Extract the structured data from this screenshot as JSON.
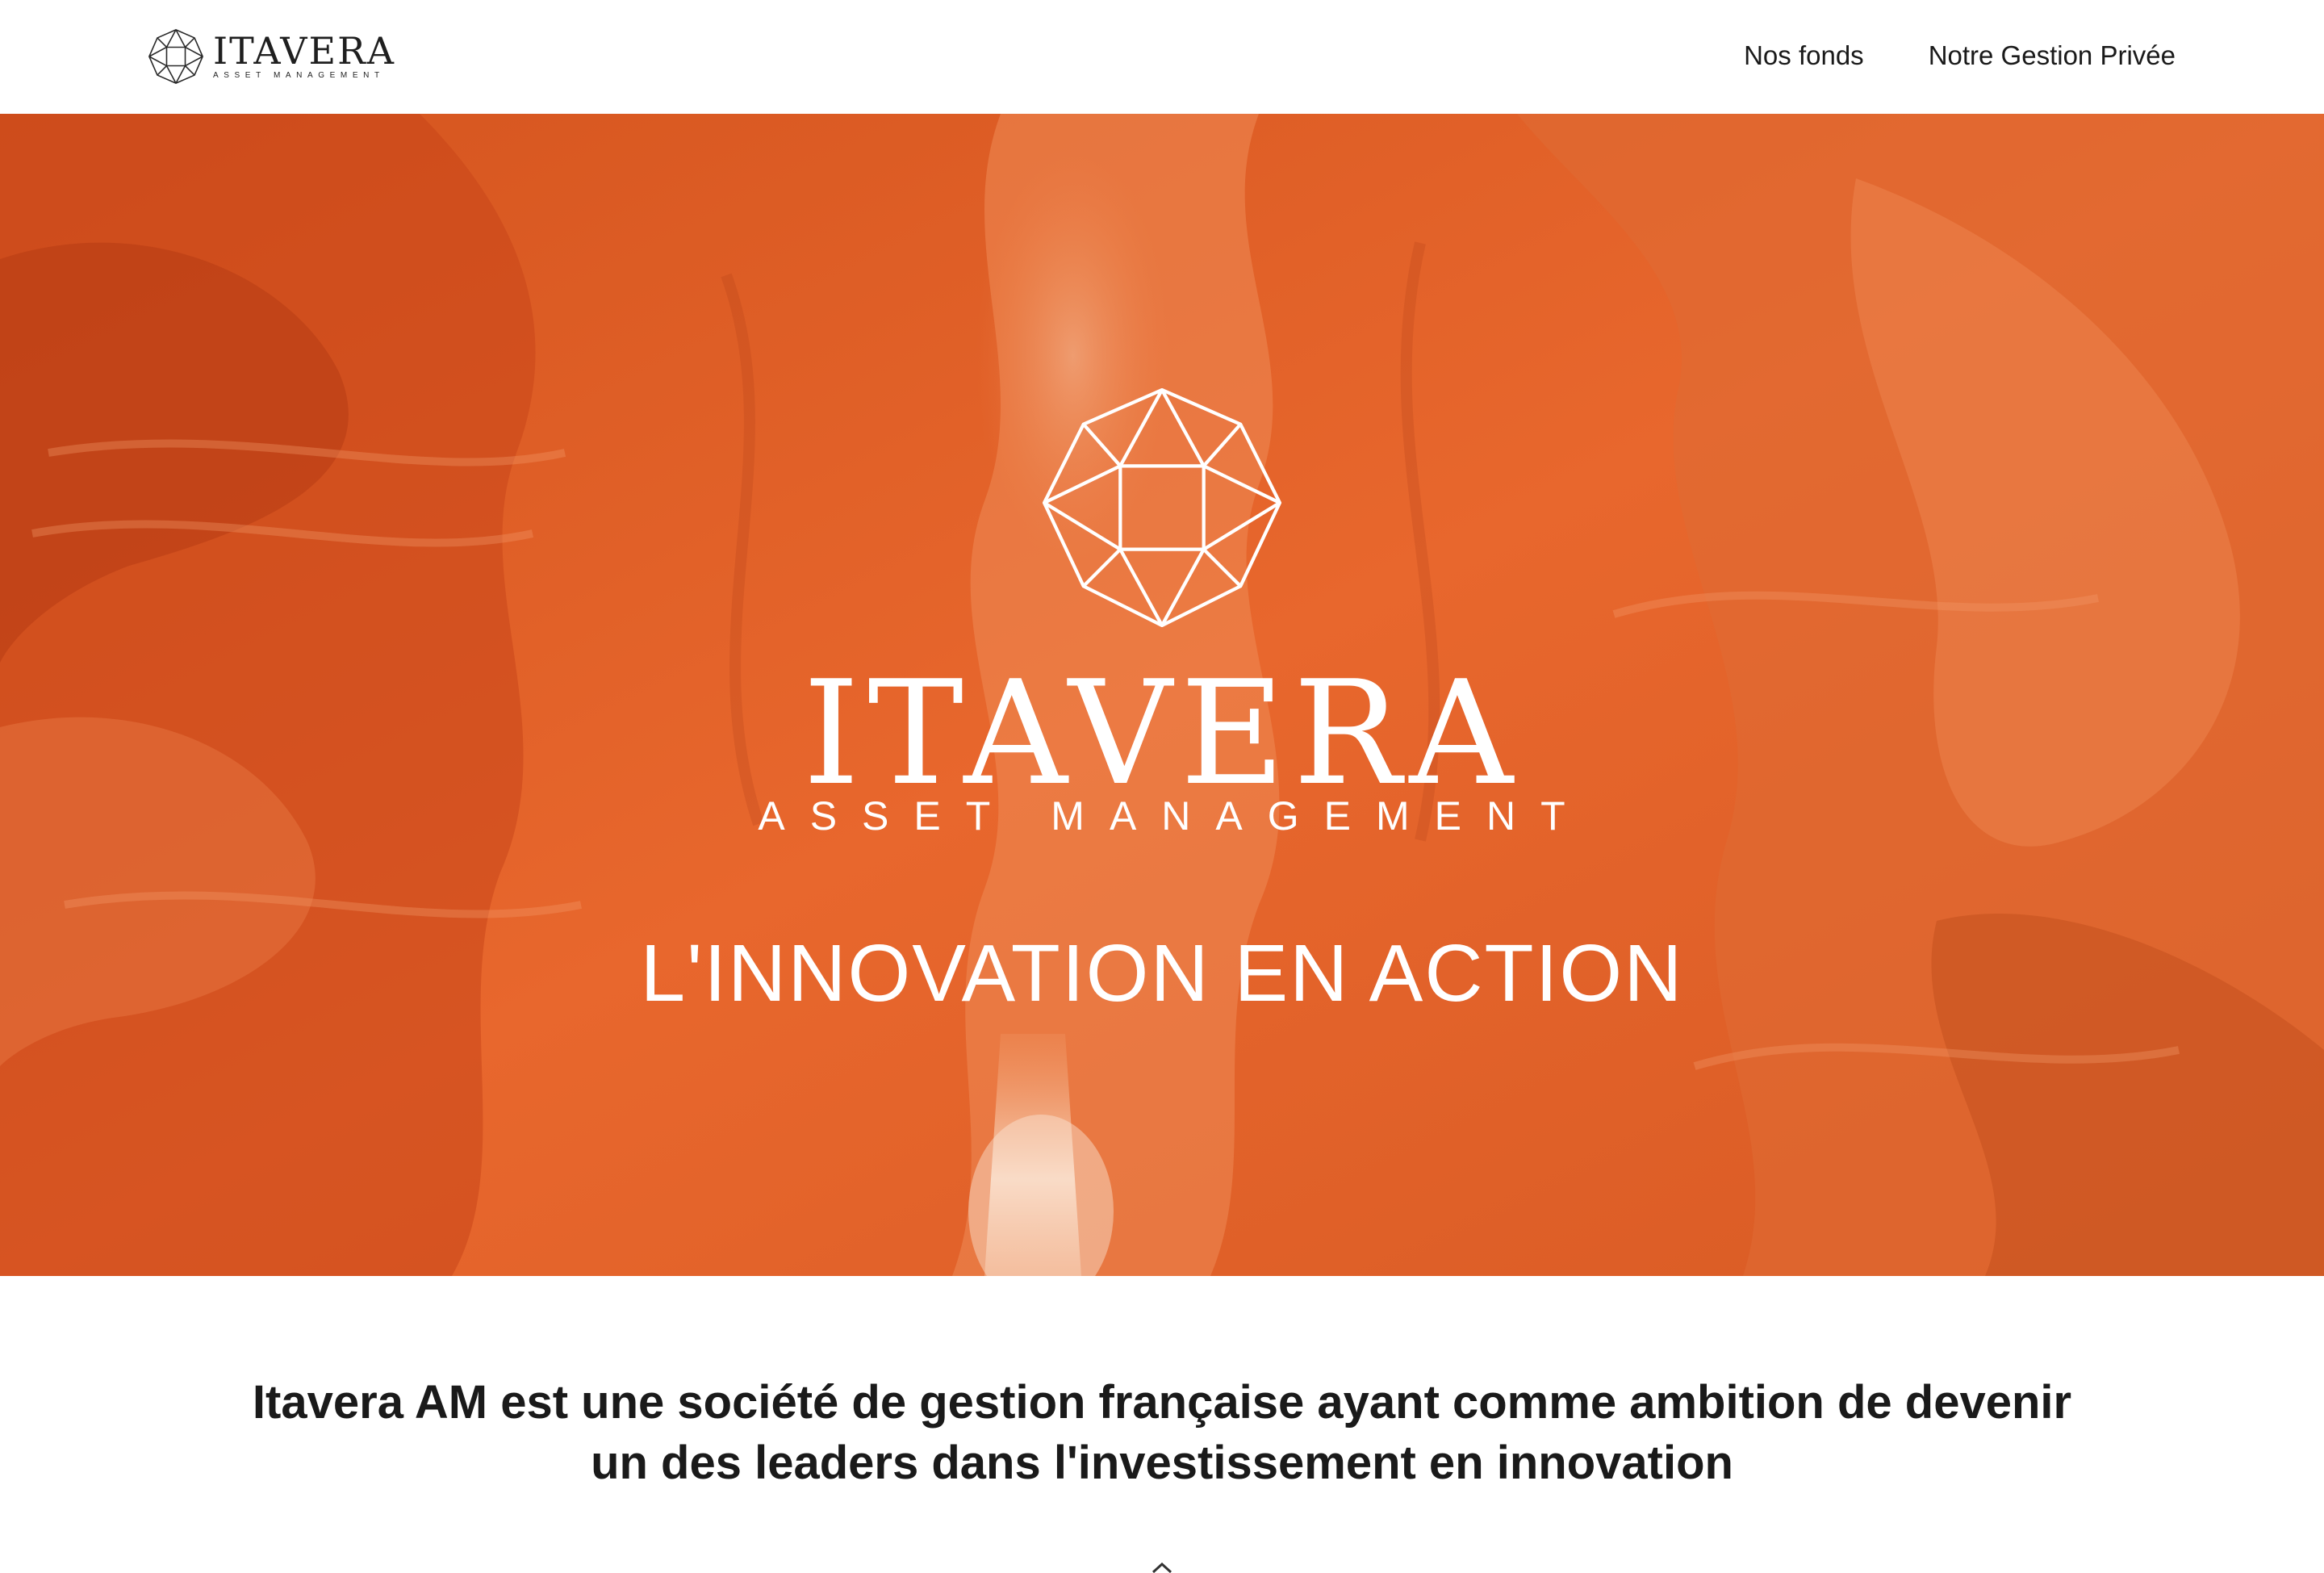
{
  "header": {
    "logo": {
      "wordmark": "ITAVERA",
      "subtitle": "ASSET MANAGEMENT",
      "icon": "gem-icon"
    },
    "nav": [
      {
        "label": "Nos fonds"
      },
      {
        "label": "Notre Gestion Privée"
      }
    ]
  },
  "hero": {
    "emblem_icon": "gem-icon",
    "title": "ITAVERA",
    "subtitle": "ASSET MANAGEMENT",
    "tagline": "L'INNOVATION EN ACTION",
    "background": "orange canyon rock photograph",
    "accent_color": "#e2622a"
  },
  "intro": {
    "text": "Itavera AM est une société de gestion française ayant comme ambition de devenir un des leaders dans l'investissement en innovation"
  },
  "scroll_hint_icon": "chevron-up-icon"
}
